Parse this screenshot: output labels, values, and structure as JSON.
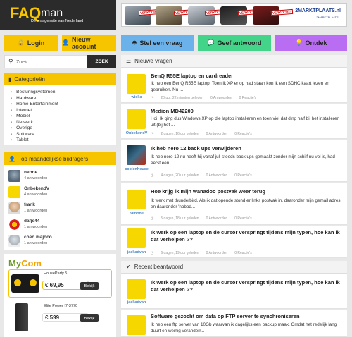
{
  "header": {
    "logo_main": "FAQ",
    "logo_sub": "man",
    "tagline": "De vraagensite van Nederland",
    "banner": {
      "sold_label": "VERKOCHT!",
      "brand": "2MARKTPLAATS.nl",
      "brand_sub": "2MARKTPLAATS..."
    }
  },
  "nav": {
    "login": "Login",
    "new_account": "Nieuw account",
    "ask": "Stel een vraag",
    "answer": "Geef antwoord",
    "discover": "Ontdek"
  },
  "colors": {
    "yellow": "#f6c500",
    "blue": "#6cb2ea",
    "green": "#43d48a",
    "purple": "#b96df2",
    "dark": "#2b2b2b"
  },
  "search": {
    "placeholder": "Zoek...",
    "button": "ZOEK"
  },
  "categories": {
    "title": "Categorieën",
    "items": [
      "Besturingsystemen",
      "Hardware",
      "Home Entertainment",
      "Internet",
      "Mobiel",
      "Netwerk",
      "Overige",
      "Software",
      "Tablet"
    ]
  },
  "contributors": {
    "title": "Top maandelijkse bijdragers",
    "items": [
      {
        "name": "nenne",
        "count": "4 antwoorden"
      },
      {
        "name": "OnbekendV",
        "count": "4 antwoorden"
      },
      {
        "name": "frank",
        "count": "1 antwoorden"
      },
      {
        "name": "dafje44",
        "count": "1 antwoorden"
      },
      {
        "name": "coen.majoco",
        "count": "1 antwoorden"
      }
    ]
  },
  "ad": {
    "brand_a": "My",
    "brand_b": "Com",
    "products": [
      {
        "name": "HouseParty 5",
        "price": "€ 69,95",
        "cta": "Bekijk"
      },
      {
        "name": "Elite Power I7-3770",
        "price": "€ 599",
        "cta": "Bekijk"
      }
    ]
  },
  "new_questions": {
    "title": "Nieuwe vragen",
    "items": [
      {
        "user": "wiella",
        "title": "BenQ R55E laptop en cardreader",
        "body": "Ik heb een BenQ R55E laptop. Toen ik XP er op had staan kon ik een SDHC kaart lezen en gebruiken. Nu ...",
        "time": "20 uur, 22 minuten geleden",
        "answers": "0 Antwoorden",
        "reactions": "0 Reactie's"
      },
      {
        "user": "OnbekendV",
        "title": "Medion MD42200",
        "body": "Hoi, Ik ging dus Windows XP op die laptop installeren en toen viel dat ding half bij het installeren uit (bij het ...",
        "time": "2 dagen, 16 uur geleden",
        "answers": "0 Antwoorden",
        "reactions": "0 Reactie's"
      },
      {
        "user": "coolenheuse",
        "title": "Ik heb nero 12 back ups verwijderen",
        "body": "Ik heb nero 12 nu heeft hij vanaf juli steeds back ups gemaakt zonder mijn schijf nu vol is, had eerst een ...",
        "time": "4 dagen, 20 uur geleden",
        "answers": "0 Antwoorden",
        "reactions": "0 Reactie's"
      },
      {
        "user": "Simone",
        "title": "Hoe krijg ik mijn wanadoo postvak weer terug",
        "body": "Ik werk met thunderbird. Als ik dat opende stond er links postvak in, daaronder mijn gemail adres en daaronder 'nobod...",
        "time": "5 dagen, 18 uur geleden",
        "answers": "0 Antwoorden",
        "reactions": "0 Reactie's"
      },
      {
        "user": "jackadvan",
        "title": "Ik werk op een laptop en de cursor verspringt tijdens mijn typen, hoe kan ik dat verhelpen ??",
        "body": "",
        "time": "6 dagen, 19 uur geleden",
        "answers": "0 Antwoorden",
        "reactions": "0 Reactie's"
      }
    ]
  },
  "recent_answered": {
    "title": "Recent beantwoord",
    "items": [
      {
        "user": "jackadvan",
        "title": "Ik werk op een laptop en de cursor verspringt tijdens mijn typen, hoe kan ik dat verhelpen ??",
        "body": ""
      },
      {
        "user": "",
        "title": "Software gezocht om data op FTP server te synchroniseren",
        "body": "Ik heb een ftp server van 10Gb waarvan ik dagelijks een backup maak. Omdat het redelijk lang duurt en weinig veranderr..."
      }
    ]
  }
}
